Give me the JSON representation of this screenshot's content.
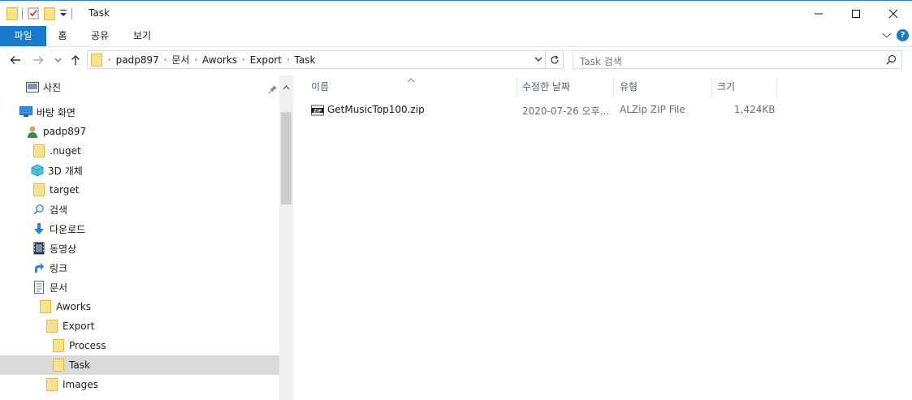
{
  "window": {
    "title": "Task"
  },
  "ribbon": {
    "tabs": [
      "파일",
      "홈",
      "공유",
      "보기"
    ]
  },
  "address": {
    "crumbs": [
      "padp897",
      "문서",
      "Aworks",
      "Export",
      "Task"
    ]
  },
  "search": {
    "placeholder": "Task 검색"
  },
  "sidebar": {
    "items": [
      {
        "label": "사진",
        "icon": "picture-icon"
      },
      {
        "label": "바탕 화면",
        "icon": "desktop-icon"
      },
      {
        "label": "padp897",
        "icon": "user-icon"
      },
      {
        "label": ".nuget",
        "icon": "folder-icon"
      },
      {
        "label": "3D 개체",
        "icon": "3d-objects-icon"
      },
      {
        "label": "target",
        "icon": "folder-icon"
      },
      {
        "label": "검색",
        "icon": "search-icon"
      },
      {
        "label": "다운로드",
        "icon": "download-icon"
      },
      {
        "label": "동영상",
        "icon": "video-icon"
      },
      {
        "label": "링크",
        "icon": "link-icon"
      },
      {
        "label": "문서",
        "icon": "document-icon"
      },
      {
        "label": "Aworks",
        "icon": "folder-icon"
      },
      {
        "label": "Export",
        "icon": "folder-icon"
      },
      {
        "label": "Process",
        "icon": "folder-icon"
      },
      {
        "label": "Task",
        "icon": "folder-icon"
      },
      {
        "label": "Images",
        "icon": "folder-icon"
      }
    ]
  },
  "columns": {
    "name": "이름",
    "modified": "수정한 날짜",
    "type": "유형",
    "size": "크기"
  },
  "files": [
    {
      "name": "GetMusicTop100.zip",
      "modified": "2020-07-26 오후...",
      "type": "ALZip ZIP File",
      "size": "1,424KB",
      "icon": "zip-icon"
    }
  ],
  "colors": {
    "accent": "#1979ca",
    "selected": "#d9d9d9",
    "header_text": "#4c607a"
  }
}
